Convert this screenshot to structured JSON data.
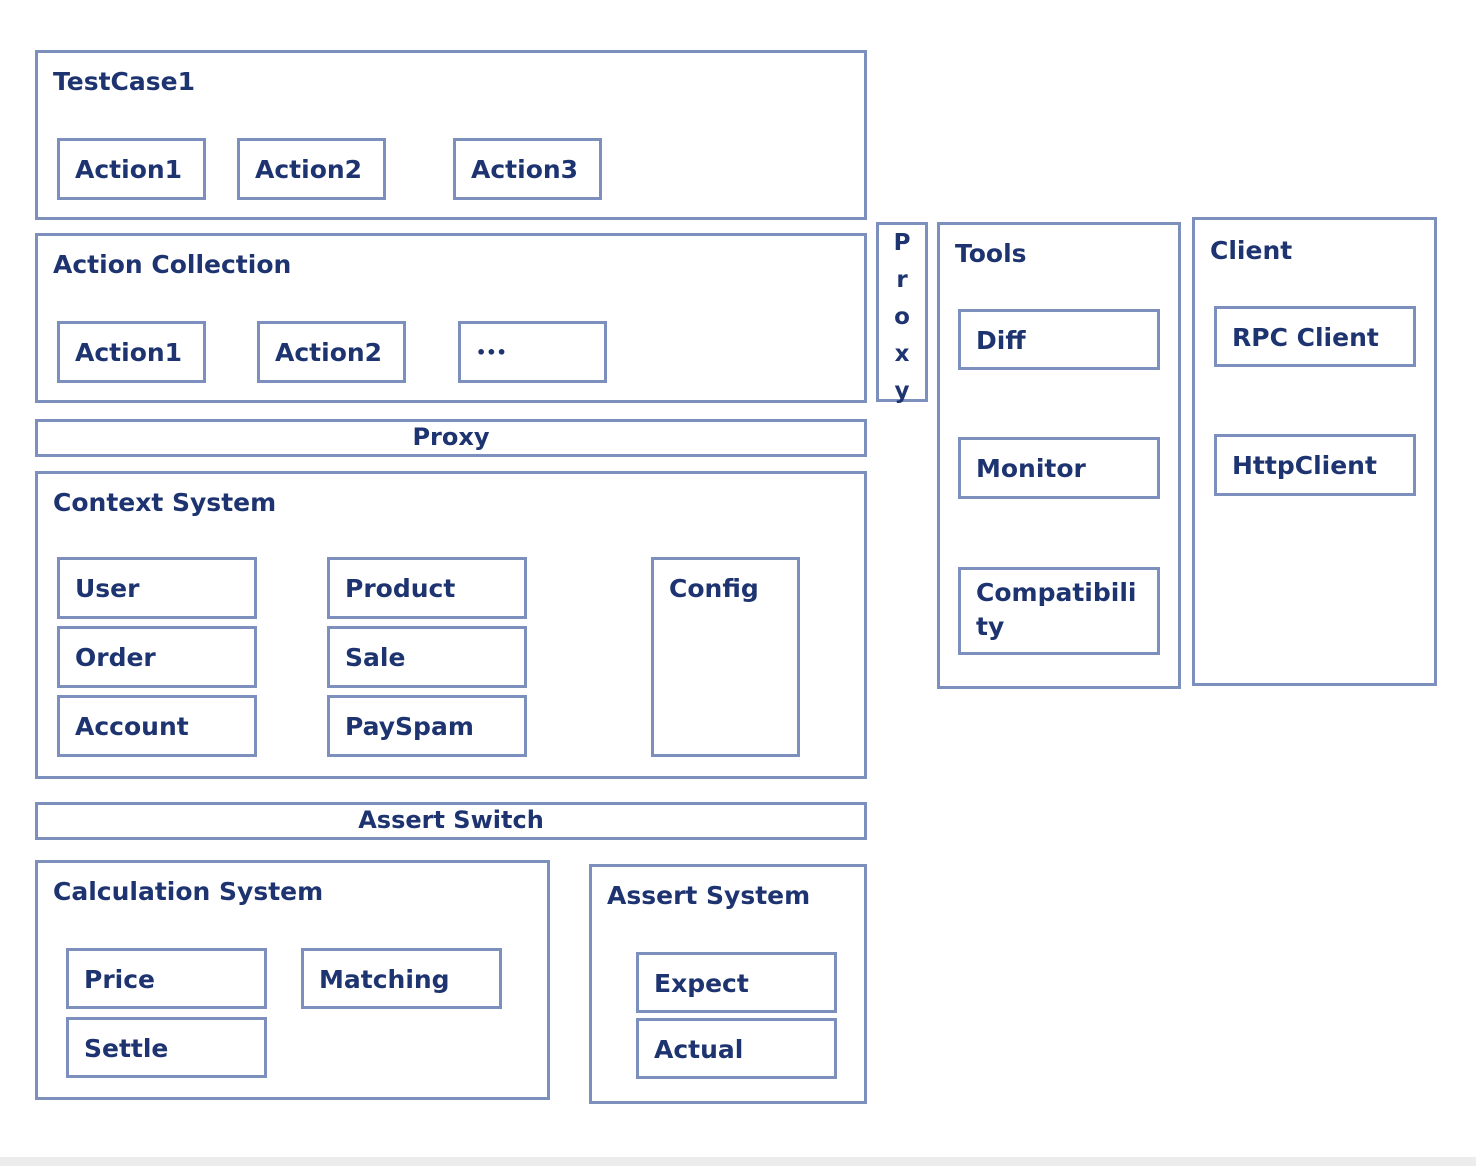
{
  "testcase": {
    "title": "TestCase1",
    "actions": [
      "Action1",
      "Action2",
      "Action3"
    ]
  },
  "action_collection": {
    "title": "Action Collection",
    "actions": [
      "Action1",
      "Action2",
      "•••"
    ]
  },
  "proxy_bar": "Proxy",
  "proxy_vertical": [
    "P",
    "r",
    "o",
    "x",
    "y"
  ],
  "context": {
    "title": "Context System",
    "items": [
      "User",
      "Order",
      "Account",
      "Product",
      "Sale",
      "PaySpam",
      "Config"
    ]
  },
  "assert_switch": "Assert Switch",
  "calculation": {
    "title": "Calculation System",
    "items": [
      "Price",
      "Settle",
      "Matching"
    ]
  },
  "assert_system": {
    "title": "Assert System",
    "items": [
      "Expect",
      "Actual"
    ]
  },
  "tools": {
    "title": "Tools",
    "items": [
      "Diff",
      "Monitor",
      "Compatibili\nty"
    ]
  },
  "client": {
    "title": "Client",
    "items": [
      "RPC Client",
      "HttpClient"
    ]
  },
  "colors": {
    "border": "#7d8fbd",
    "text": "#1e3470"
  }
}
